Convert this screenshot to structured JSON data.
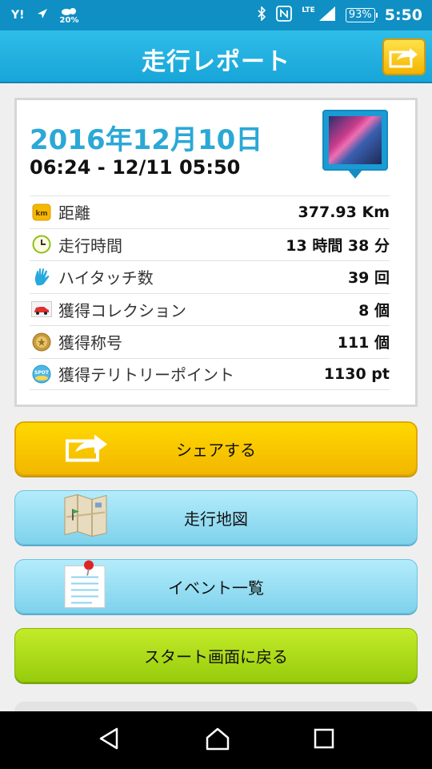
{
  "status_bar": {
    "weather_percent": "20%",
    "network": "LTE",
    "battery": "93%",
    "time": "5:50"
  },
  "app_bar": {
    "title": "走行レポート"
  },
  "report": {
    "date": "2016年12月10日",
    "time_range": "06:24 - 12/11 05:50",
    "stats": [
      {
        "icon": "km-icon",
        "label": "距離",
        "value": "377.93 Km"
      },
      {
        "icon": "clock-icon",
        "label": "走行時間",
        "value": "13 時間 38 分"
      },
      {
        "icon": "high-touch-icon",
        "label": "ハイタッチ数",
        "value": "39 回"
      },
      {
        "icon": "car-collection-icon",
        "label": "獲得コレクション",
        "value": "8 個"
      },
      {
        "icon": "title-medal-icon",
        "label": "獲得称号",
        "value": "111 個"
      },
      {
        "icon": "spot-icon",
        "label": "獲得テリトリーポイント",
        "value": "1130 pt"
      }
    ]
  },
  "buttons": {
    "share": "シェアする",
    "map": "走行地図",
    "events": "イベント一覧",
    "start": "スタート画面に戻る"
  },
  "colors": {
    "status_bar": "#0f8fc4",
    "app_bar": "#2fbde9",
    "date_text": "#2ba8d6",
    "share_button": "#ffd800",
    "map_button": "#b4ecfb",
    "start_button": "#c3eb2a"
  }
}
